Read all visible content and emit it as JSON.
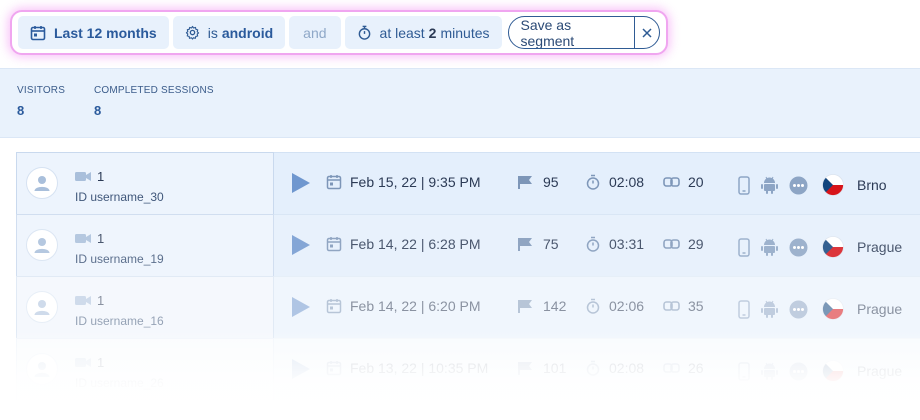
{
  "filters": {
    "date_range": "Last 12 months",
    "os_prefix": "is",
    "os_value": "android",
    "conjunction": "and",
    "duration_prefix": "at least",
    "duration_value": "2",
    "duration_suffix": "minutes",
    "save_label": "Save as segment"
  },
  "stats": {
    "visitors_label": "VISITORS",
    "visitors_value": "8",
    "completed_label": "COMPLETED SESSIONS",
    "completed_value": "8"
  },
  "sessions": [
    {
      "recordings": "1",
      "user_id": "ID username_30",
      "date": "Feb 15, 22 | 9:35 PM",
      "events": "95",
      "duration": "02:08",
      "pages": "20",
      "city": "Brno"
    },
    {
      "recordings": "1",
      "user_id": "ID username_19",
      "date": "Feb 14, 22 | 6:28 PM",
      "events": "75",
      "duration": "03:31",
      "pages": "29",
      "city": "Prague"
    },
    {
      "recordings": "1",
      "user_id": "ID username_16",
      "date": "Feb 14, 22 | 6:20 PM",
      "events": "142",
      "duration": "02:06",
      "pages": "35",
      "city": "Prague"
    },
    {
      "recordings": "1",
      "user_id": "ID username_26",
      "date": "Feb 13, 22 | 10:35 PM",
      "events": "101",
      "duration": "02:08",
      "pages": "26",
      "city": "Prague"
    }
  ],
  "icons": {
    "date": "calendar-icon",
    "os": "gear-icon",
    "duration": "stopwatch-icon",
    "close": "close-icon",
    "camera": "video-camera-icon",
    "play": "play-icon",
    "events": "flag-icon",
    "pages": "link-icon",
    "device": "smartphone-icon",
    "os_logo": "android-icon",
    "browser": "more-dots-icon",
    "country": "czech-flag-icon"
  },
  "colors": {
    "accent": "#2a5a9c",
    "highlight_glow": "#f0a6f0",
    "chip_bg": "#e8f1fc",
    "row_bg": "#e4effc"
  }
}
